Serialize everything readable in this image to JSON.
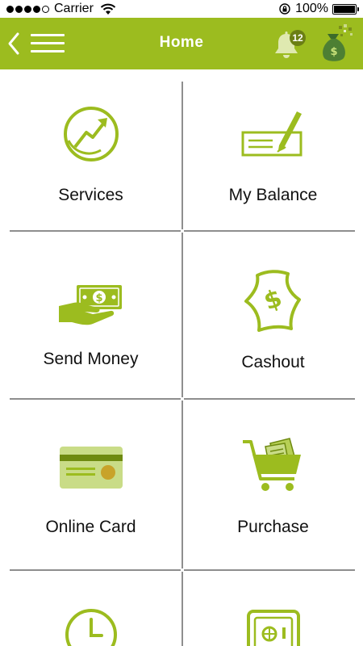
{
  "status_bar": {
    "carrier": "Carrier",
    "battery": "100%",
    "signal_bars": 5,
    "signal_filled": 4
  },
  "header": {
    "title": "Home",
    "notification_count": "12",
    "bg_color": "#9cbc1f"
  },
  "accent_color": "#9cbc1f",
  "tiles": [
    {
      "label": "Services",
      "icon": "services-arrow-circle-icon"
    },
    {
      "label": "My Balance",
      "icon": "cheque-pen-icon"
    },
    {
      "label": "Send Money",
      "icon": "hand-cash-icon"
    },
    {
      "label": "Cashout",
      "icon": "dollar-bill-icon"
    },
    {
      "label": "Online Card",
      "icon": "credit-card-icon"
    },
    {
      "label": "Purchase",
      "icon": "shopping-cart-icon"
    },
    {
      "label": "",
      "icon": "clock-icon"
    },
    {
      "label": "",
      "icon": "safe-icon"
    }
  ]
}
